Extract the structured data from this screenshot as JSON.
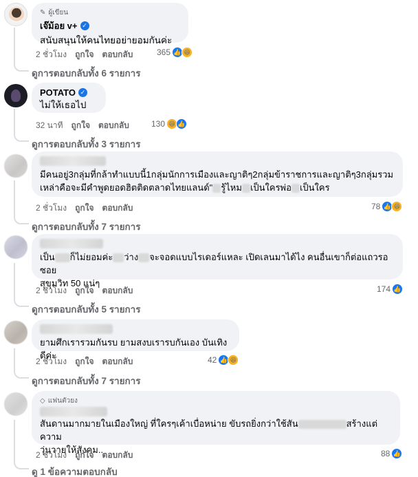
{
  "comments": [
    {
      "badge": "ผู้เขียน",
      "author": "เจ๊ม้อย v+",
      "verified": true,
      "text": "สนับสนุนให้คนไทยอย่ายอมกันค่ะ",
      "time": "2 ชั่วโมง",
      "like_label": "ถูกใจ",
      "reply_label": "ตอบกลับ",
      "reaction_count": "365",
      "reactions": [
        "like-icon",
        "haha-icon"
      ],
      "replies_label": "ดูการตอบกลับทั้ง 6 รายการ"
    },
    {
      "author": "POTATO",
      "verified": true,
      "text": "ไม่ให้เธอไป",
      "time": "32 นาที",
      "like_label": "ถูกใจ",
      "reply_label": "ตอบกลับ",
      "reaction_count": "130",
      "reactions": [
        "haha-icon",
        "like-icon"
      ],
      "replies_label": "ดูการตอบกลับทั้ง 3 รายการ"
    },
    {
      "text_line1": "มีคนอยู่3กลุ่มที่กล้าทำแบบนี้1กลุ่มนักการเมืองและญาติๆ2กลุ่มข้าราชการและญาติๆ3กลุ่มรวม",
      "text_line2": "เหล่าคือจะมีคำพูดยอดฮิตติดตลาดไทยแลนด์\"",
      "text_line2b": "รู้ไหม",
      "text_line2c": "เป็นใครพ่อ",
      "text_line2d": "เป็นใคร",
      "time": "2 ชั่วโมง",
      "like_label": "ถูกใจ",
      "reply_label": "ตอบกลับ",
      "reaction_count": "78",
      "reactions": [
        "like-icon",
        "haha-icon"
      ],
      "replies_label": "ดูการตอบกลับทั้ง 7 รายการ"
    },
    {
      "t1": "เป็น",
      "t2": "ก็ไม่ยอมค่ะ",
      "t3": "ว่าง",
      "t4": "จะจอดแบบไรเดอร์แหละ เปิดเลนมาได้ไง คนอื่นเขาก็ต่อแถวรอ ซอย",
      "text_line2": "สุขุมวิท 50 แน่ๆ",
      "time": "2 ชั่วโมง",
      "like_label": "ถูกใจ",
      "reply_label": "ตอบกลับ",
      "reaction_count": "174",
      "reactions": [
        "like-icon"
      ],
      "replies_label": "ดูการตอบกลับทั้ง 5 รายการ"
    },
    {
      "text": "ยามศึกเรารวมกันรบ ยามสงบเรารบกันเอง บันเทิงดีค่ะ",
      "time": "2 ชั่วโมง",
      "like_label": "ถูกใจ",
      "reply_label": "ตอบกลับ",
      "reaction_count": "42",
      "reactions": [
        "like-icon",
        "haha-icon"
      ],
      "replies_label": "ดูการตอบกลับทั้ง 7 รายการ"
    },
    {
      "badge": "แฟนตัวยง",
      "text_line1a": "สันดานมากมายในเมืองใหญ่ ที่ใครๆเค้าเบื่อหน่าย ขับรถยิ่งกว่าใช้สัน",
      "text_line1b": "สร้างแต่ความ",
      "text_line2": "วุ่นวายให้สังคม..",
      "time": "2 ชั่วโมง",
      "like_label": "ถูกใจ",
      "reply_label": "ตอบกลับ",
      "reaction_count": "88",
      "reactions": [
        "like-icon"
      ],
      "replies_label": "ดู 1 ข้อความตอบกลับ"
    }
  ],
  "colors": {
    "bubble": "#f0f2f5",
    "secondary_text": "#65676b",
    "like_blue": "#1877f2",
    "haha_yellow": "#f7b125"
  }
}
